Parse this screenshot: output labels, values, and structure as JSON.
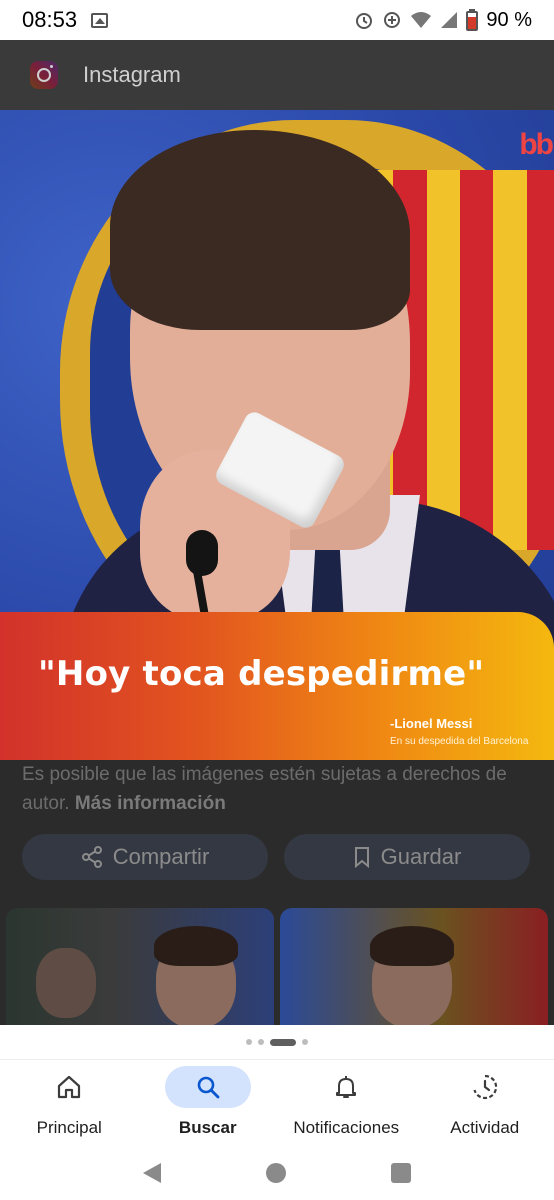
{
  "status_bar": {
    "time": "08:53",
    "battery_percent": "90 %",
    "icons": [
      "gallery-icon",
      "alarm-icon",
      "data-saver-icon",
      "wifi-icon",
      "signal-icon",
      "battery-icon"
    ]
  },
  "app_bar": {
    "title": "Instagram",
    "icon": "instagram-logo-icon"
  },
  "image": {
    "quote": "\"Hoy toca despedirme\"",
    "credit_name": "-Lionel Messi",
    "credit_subtitle": "En su despedida del Barcelona"
  },
  "copyright": {
    "text": "Es posible que las imágenes estén sujetas a derechos de autor.",
    "link": "Más información"
  },
  "actions": {
    "share_label": "Compartir",
    "save_label": "Guardar"
  },
  "bottom_nav": {
    "items": [
      {
        "label": "Principal",
        "icon": "home-icon",
        "active": false
      },
      {
        "label": "Buscar",
        "icon": "search-icon",
        "active": true
      },
      {
        "label": "Notificaciones",
        "icon": "bell-icon",
        "active": false
      },
      {
        "label": "Actividad",
        "icon": "activity-icon",
        "active": false
      }
    ]
  },
  "colors": {
    "nav_active_pill": "#d3e3fd",
    "banner_start": "#d2322b",
    "banner_end": "#f4b80f"
  }
}
